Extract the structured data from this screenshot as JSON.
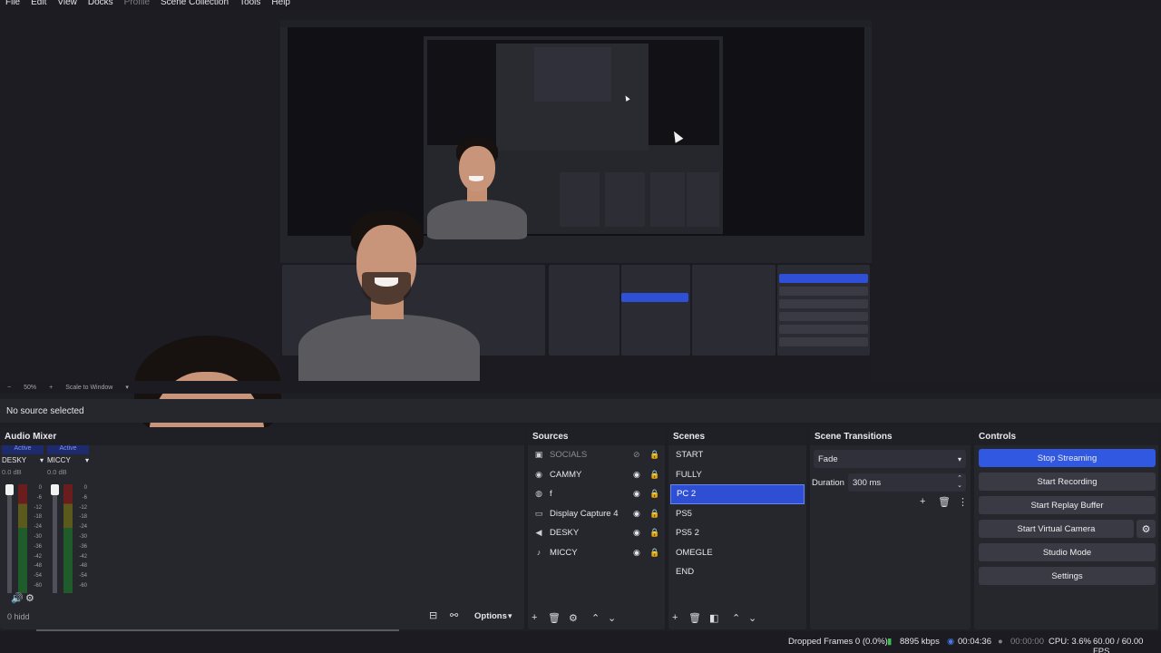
{
  "menu": [
    "File",
    "Edit",
    "View",
    "Docks",
    "Profile",
    "Scene Collection",
    "Tools",
    "Help"
  ],
  "menu_disabled": [
    "Profile"
  ],
  "zoom": {
    "level": "50%",
    "mode": "Scale to Window"
  },
  "source_toolbar": {
    "status": "No source selected"
  },
  "audio_mixer": {
    "title": "Audio Mixer",
    "channels": [
      {
        "name": "DESKY",
        "state": "Active",
        "volume": "0.0 dB"
      },
      {
        "name": "MICCY",
        "state": "Active",
        "volume": "0.0 dB"
      }
    ],
    "scale": [
      "0",
      "-6",
      "-12",
      "-18",
      "-24",
      "-30",
      "-36",
      "-42",
      "-48",
      "-54",
      "-60"
    ],
    "hidden_label": "0 hidd"
  },
  "sources": {
    "title": "Sources",
    "items": [
      {
        "name": "SOCIALS",
        "icon": "image-icon",
        "visible": false
      },
      {
        "name": "CAMMY",
        "icon": "camera-icon",
        "visible": true
      },
      {
        "name": "f",
        "icon": "browser-icon",
        "visible": true
      },
      {
        "name": "Display Capture 4",
        "icon": "monitor-icon",
        "visible": true
      },
      {
        "name": "DESKY",
        "icon": "speaker-icon",
        "visible": true
      },
      {
        "name": "MICCY",
        "icon": "microphone-icon",
        "visible": true
      }
    ],
    "options_label": "Options"
  },
  "scenes": {
    "title": "Scenes",
    "items": [
      "START",
      "FULLY",
      "PC 2",
      "PS5",
      "PS5 2",
      "OMEGLE",
      "END"
    ],
    "selected": "PC 2"
  },
  "scene_transitions": {
    "title": "Scene Transitions",
    "transition": "Fade",
    "duration_label": "Duration",
    "duration_value": "300 ms"
  },
  "controls": {
    "title": "Controls",
    "stop_streaming": "Stop Streaming",
    "start_recording": "Start Recording",
    "start_replay_buffer": "Start Replay Buffer",
    "start_virtual_camera": "Start Virtual Camera",
    "studio_mode": "Studio Mode",
    "settings": "Settings"
  },
  "status": {
    "dropped_frames": "Dropped Frames 0 (0.0%)",
    "bitrate": "8895 kbps",
    "stream_time": "00:04:36",
    "record_time": "00:00:00",
    "cpu": "CPU: 3.6%",
    "fps": "60.00 / 60.00 FPS"
  },
  "colors": {
    "accent": "#3058e0",
    "panel": "#26262d",
    "background": "#1e1e25"
  }
}
